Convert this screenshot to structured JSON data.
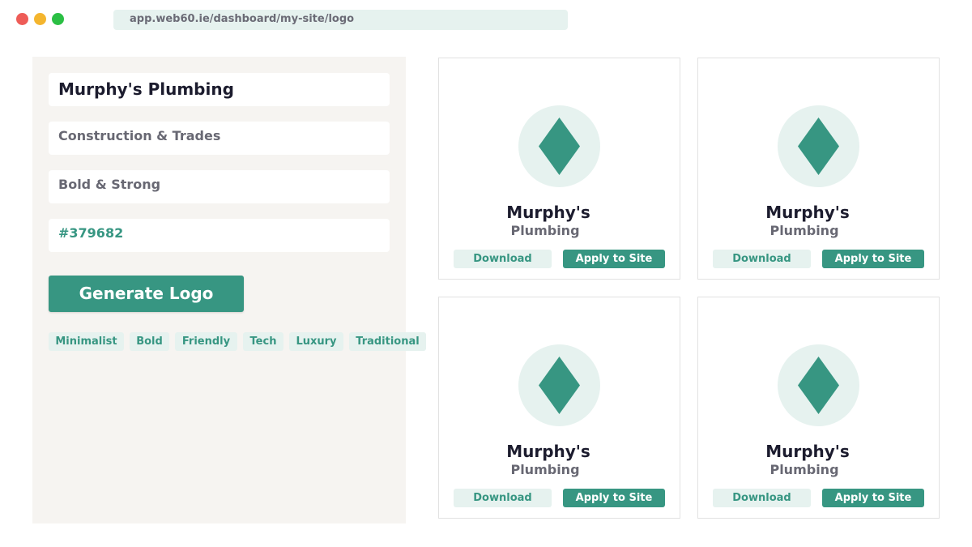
{
  "browser": {
    "url": "app.web60.ie/dashboard/my-site/logo"
  },
  "form": {
    "business_name": "Murphy's Plumbing",
    "industry": "Construction & Trades",
    "style": "Bold & Strong",
    "color_hex": "#379682",
    "generate_label": "Generate Logo",
    "style_chips": [
      "Minimalist",
      "Bold",
      "Friendly",
      "Tech",
      "Luxury",
      "Traditional"
    ]
  },
  "results": [
    {
      "name_line1": "Murphy's",
      "name_line2": "Plumbing",
      "icon": "diamond-icon",
      "download_label": "Download",
      "apply_label": "Apply to Site"
    },
    {
      "name_line1": "Murphy's",
      "name_line2": "Plumbing",
      "icon": "diamond-icon",
      "download_label": "Download",
      "apply_label": "Apply to Site"
    },
    {
      "name_line1": "Murphy's",
      "name_line2": "Plumbing",
      "icon": "diamond-icon",
      "download_label": "Download",
      "apply_label": "Apply to Site"
    },
    {
      "name_line1": "Murphy's",
      "name_line2": "Plumbing",
      "icon": "diamond-icon",
      "download_label": "Download",
      "apply_label": "Apply to Site"
    }
  ],
  "colors": {
    "accent": "#379682",
    "accent_light": "#e6f2ef",
    "panel_bg": "#f6f4f1",
    "text_dark": "#1c1c2e",
    "text_muted": "#686873"
  }
}
